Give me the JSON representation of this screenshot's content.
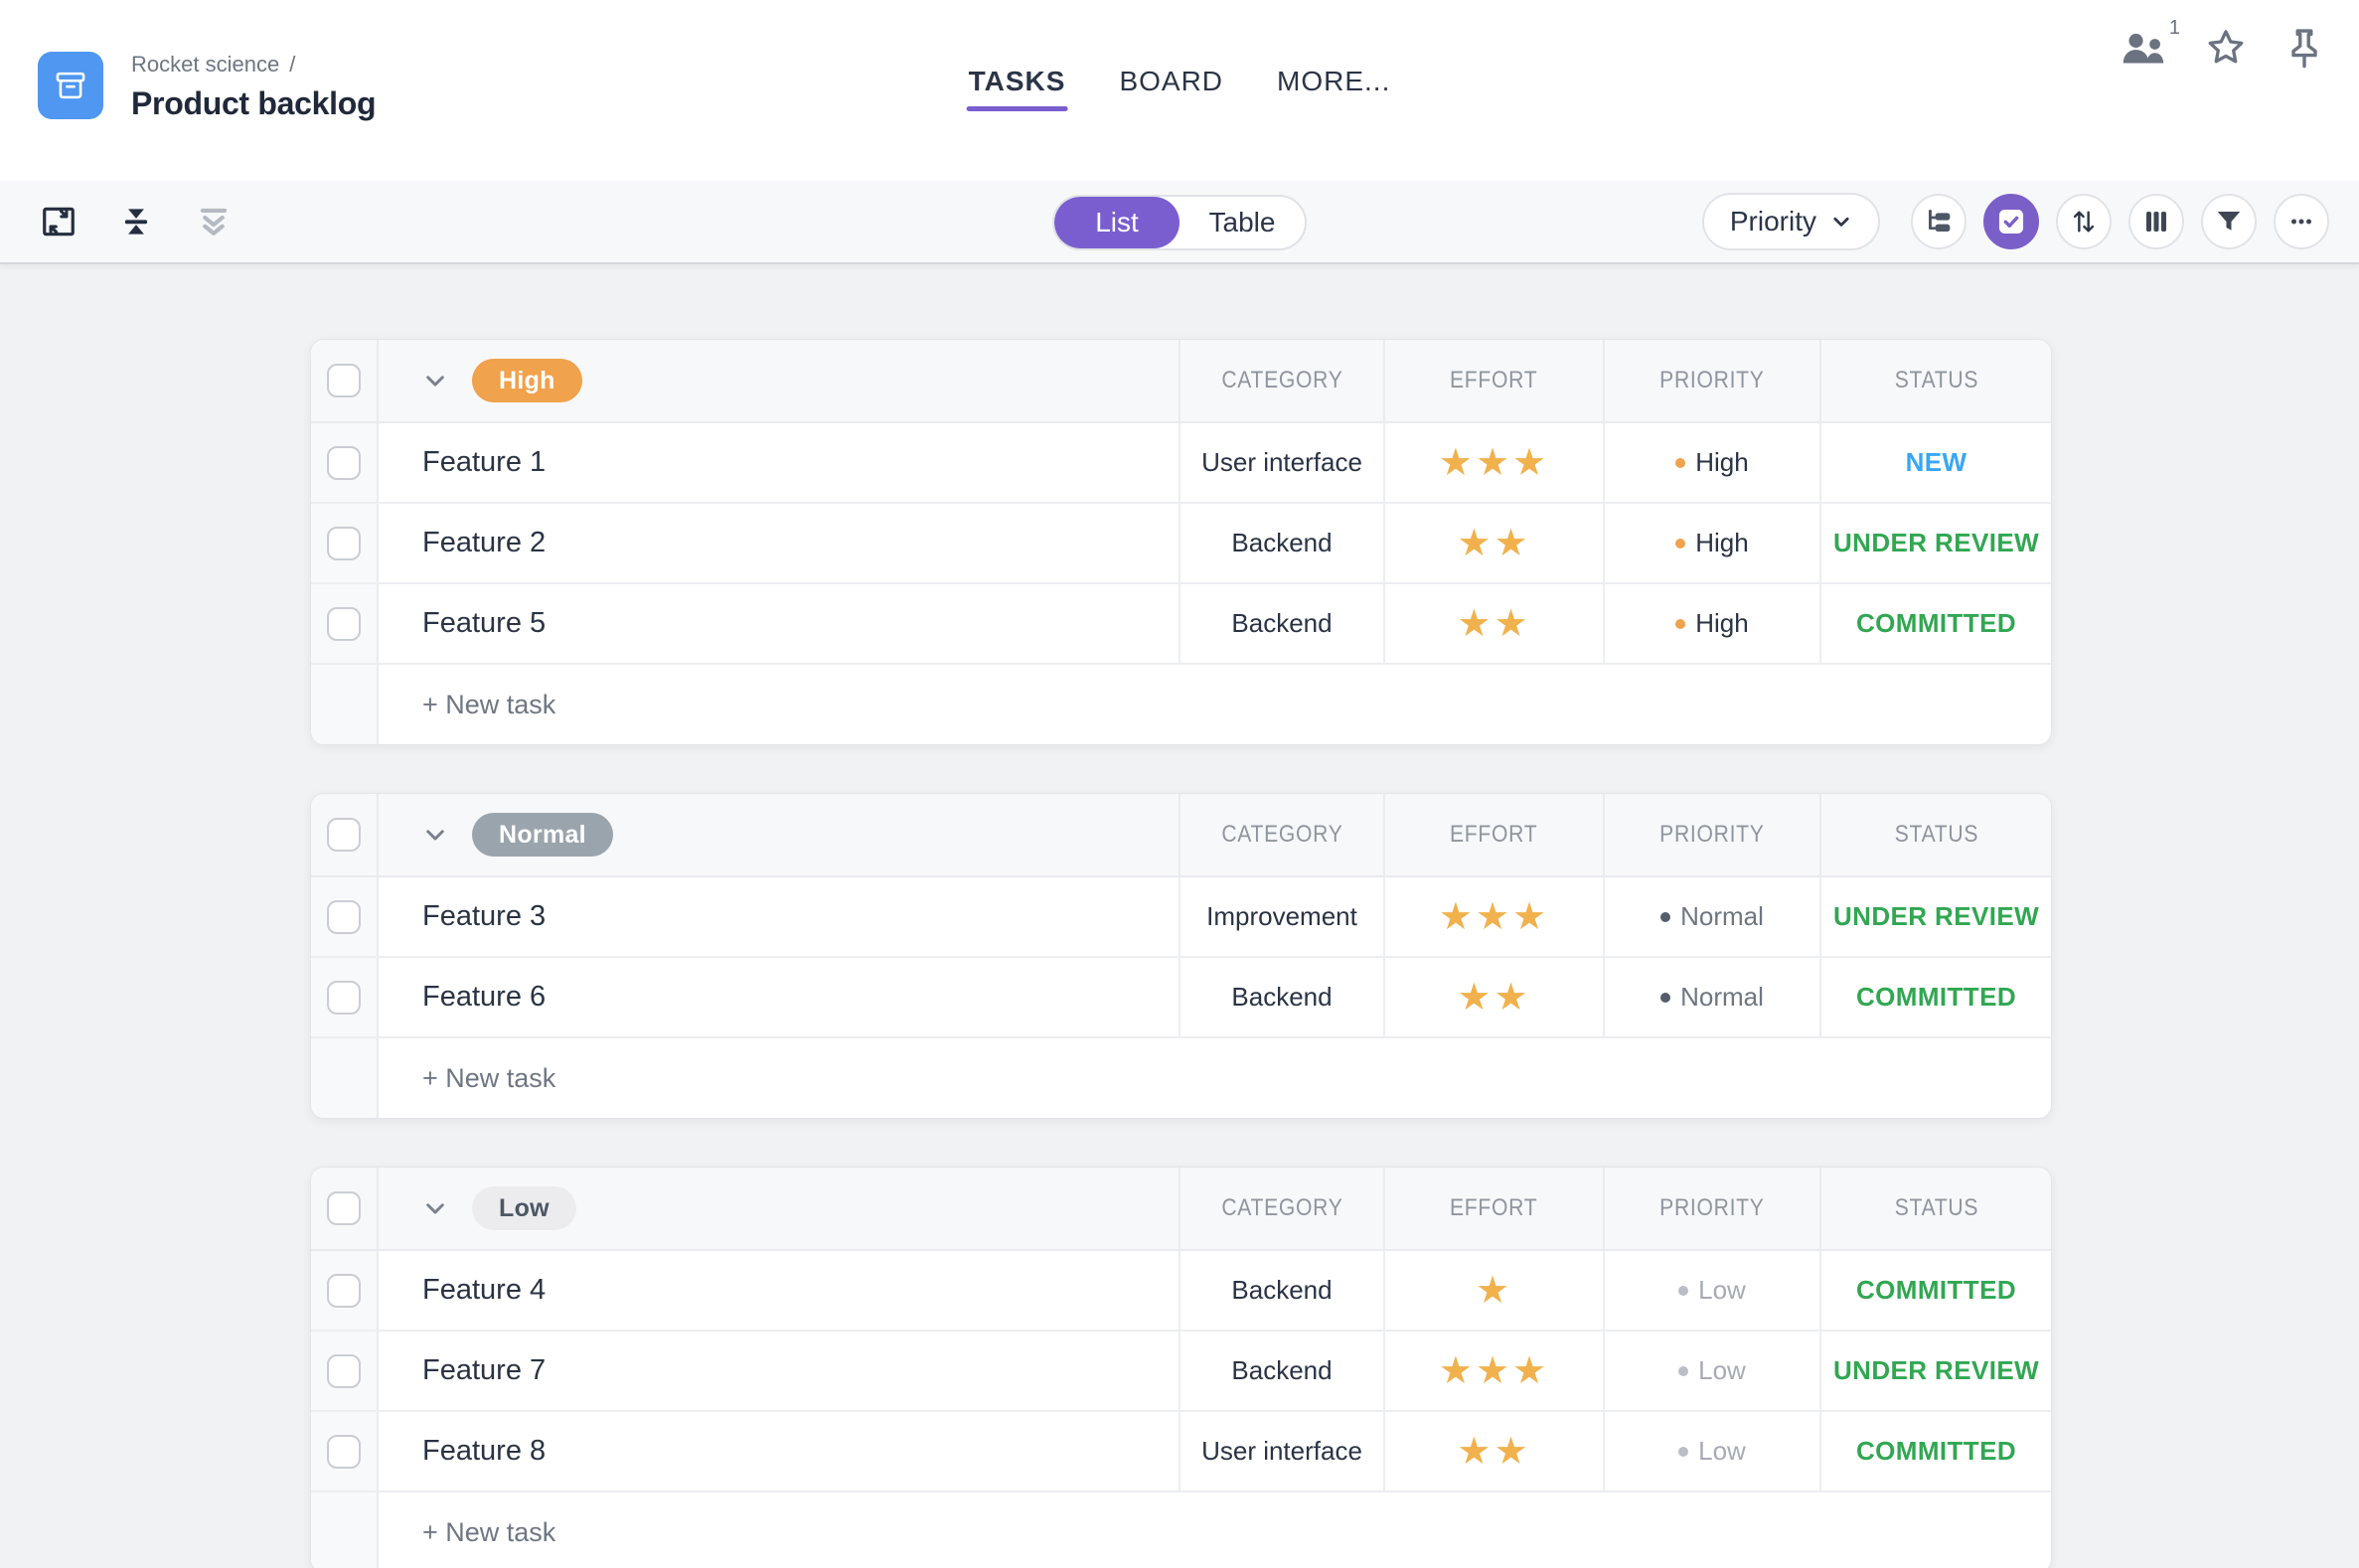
{
  "header": {
    "breadcrumb": "Rocket science",
    "breadcrumb_separator": "/",
    "title": "Product backlog",
    "tabs": [
      {
        "label": "TASKS",
        "active": true
      },
      {
        "label": "BOARD",
        "active": false
      },
      {
        "label": "MORE...",
        "active": false
      }
    ],
    "collaborators_badge": "1",
    "icons": [
      "archive-box-icon",
      "collaborators-icon",
      "star-icon",
      "pin-icon"
    ]
  },
  "toolbar": {
    "icons_left": [
      "maximize-icon",
      "collapse-rows-icon",
      "expand-all-icon"
    ],
    "view_toggle": [
      {
        "label": "List",
        "active": true
      },
      {
        "label": "Table",
        "active": false
      }
    ],
    "group_by": {
      "label": "Priority"
    },
    "icons_right": [
      "hierarchy-icon",
      "select-tasks-icon",
      "sort-icon",
      "columns-icon",
      "filter-icon",
      "more-icon"
    ],
    "accent_color": "#7a5ed0"
  },
  "table": {
    "columns": [
      "CATEGORY",
      "EFFORT",
      "PRIORITY",
      "STATUS"
    ],
    "new_task_label": "+ New task",
    "effort_star_color": "#f1b14c",
    "groups": [
      {
        "name": "High",
        "badge_bg": "#f0a24c",
        "badge_text": "#ffffff",
        "dot_color": "#f0a24c",
        "priority_text_color": "#2a3344",
        "rows": [
          {
            "name": "Feature 1",
            "category": "User interface",
            "effort": 3,
            "priority": "High",
            "status": "NEW",
            "status_color": "#38a6f5"
          },
          {
            "name": "Feature 2",
            "category": "Backend",
            "effort": 2,
            "priority": "High",
            "status": "UNDER REVIEW",
            "status_color": "#31a752"
          },
          {
            "name": "Feature 5",
            "category": "Backend",
            "effort": 2,
            "priority": "High",
            "status": "COMMITTED",
            "status_color": "#31a752"
          }
        ]
      },
      {
        "name": "Normal",
        "badge_bg": "#9aa4ad",
        "badge_text": "#ffffff",
        "dot_color": "#565e6b",
        "priority_text_color": "#6e7682",
        "rows": [
          {
            "name": "Feature 3",
            "category": "Improvement",
            "effort": 3,
            "priority": "Normal",
            "status": "UNDER REVIEW",
            "status_color": "#31a752"
          },
          {
            "name": "Feature 6",
            "category": "Backend",
            "effort": 2,
            "priority": "Normal",
            "status": "COMMITTED",
            "status_color": "#31a752"
          }
        ]
      },
      {
        "name": "Low",
        "badge_bg": "#ececef",
        "badge_text": "#4d5664",
        "dot_color": "#b9bec7",
        "priority_text_color": "#a5abb5",
        "rows": [
          {
            "name": "Feature 4",
            "category": "Backend",
            "effort": 1,
            "priority": "Low",
            "status": "COMMITTED",
            "status_color": "#31a752"
          },
          {
            "name": "Feature 7",
            "category": "Backend",
            "effort": 3,
            "priority": "Low",
            "status": "UNDER REVIEW",
            "status_color": "#31a752"
          },
          {
            "name": "Feature 8",
            "category": "User interface",
            "effort": 2,
            "priority": "Low",
            "status": "COMMITTED",
            "status_color": "#31a752"
          }
        ]
      }
    ]
  }
}
